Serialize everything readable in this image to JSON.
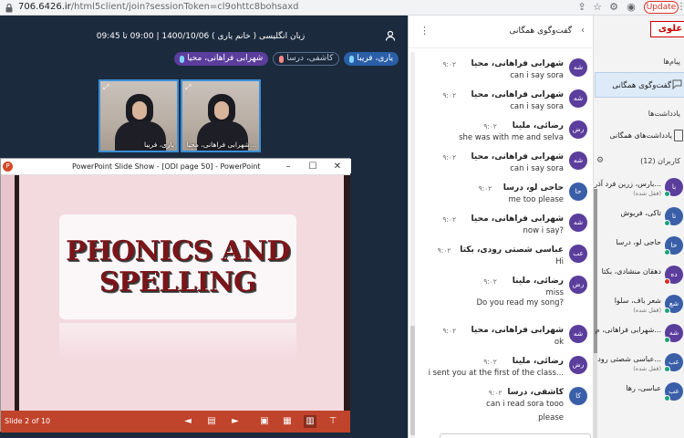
{
  "browser": {
    "url_host": "706.6426.ir",
    "url_path": "/html5client/join?sessionToken=cl9ohttc8bohsaxd",
    "update_label": "Update"
  },
  "meeting": {
    "header": "زبان انگلیسی ( خانم یاری ) 1400/10/06 | 09:00 تا 09:45",
    "presenters": [
      {
        "name": "یاری، فریبا",
        "style": "blue"
      },
      {
        "name": "کاشفی، درسا",
        "style": "outline"
      },
      {
        "name": "شهرابی فراهانی، محیا",
        "style": "purple"
      }
    ],
    "videos": [
      {
        "name": "یاری، فریبا"
      },
      {
        "name": "شهرابی فراهانی، محیا..."
      }
    ]
  },
  "ppt": {
    "title": "PowerPoint Slide Show - [ODI page 50] - PowerPoint",
    "slide_title_line1": "PHONICS AND",
    "slide_title_line2": "SPELLING",
    "status": "Slide 2 of 10",
    "accent": "#c0432b"
  },
  "chat": {
    "title": "گفت‌وگوی همگانی",
    "messages": [
      {
        "avatar": "شه",
        "color": "#5b3d9c",
        "name": "شهرابی فراهانی، محیا",
        "time": "۹:۰۲",
        "text": "can i say sora"
      },
      {
        "avatar": "شه",
        "color": "#5b3d9c",
        "name": "شهرابی فراهانی، محیا",
        "time": "۹:۰۲",
        "text": "can i say sora"
      },
      {
        "avatar": "رض",
        "color": "#5b3d9c",
        "name": "رضائی، ملینا",
        "time": "۹:۰۲",
        "text": "she was with me and selva"
      },
      {
        "avatar": "شه",
        "color": "#5b3d9c",
        "name": "شهرابی فراهانی، محیا",
        "time": "۹:۰۲",
        "text": "can i say sora"
      },
      {
        "avatar": "حا",
        "color": "#3a5fa8",
        "name": "حاجی لو، درسا",
        "time": "۹:۰۲",
        "text": "me too please"
      },
      {
        "avatar": "شه",
        "color": "#5b3d9c",
        "name": "شهرابی فراهانی، محیا",
        "time": "۹:۰۲",
        "text": "now i say?"
      },
      {
        "avatar": "عب",
        "color": "#5b3d9c",
        "name": "عباسی شصتی رودی، بکتا",
        "time": "۹:۰۲",
        "text": "Hi"
      },
      {
        "avatar": "رض",
        "color": "#5b3d9c",
        "name": "رضائی، ملینا",
        "time": "۹:۰۲",
        "text": "miss"
      },
      {
        "avatar": "",
        "color": "#5b3d9c",
        "name": "",
        "time": "",
        "text": "Do you read my song?"
      },
      {
        "avatar": "شه",
        "color": "#5b3d9c",
        "name": "شهرابی فراهانی، محیا",
        "time": "۹:۰۲",
        "text": "ok"
      },
      {
        "avatar": "رض",
        "color": "#5b3d9c",
        "name": "رضائی، ملینا",
        "time": "۹:۰۲",
        "text": "i sent you at the first of the class..."
      },
      {
        "avatar": "کا",
        "color": "#3a5fa8",
        "name": "کاشفی، درسا",
        "time": "۹:۰۲",
        "text": "can i read sora tooo"
      },
      {
        "avatar": "",
        "color": "#3a5fa8",
        "name": "",
        "time": "",
        "text": "please"
      }
    ]
  },
  "sidebar": {
    "logo": "علوی",
    "messages_label": "پیام‌ها",
    "public_chat": "گفت‌وگوی همگانی",
    "notes_label": "یادداشت‌ها",
    "shared_notes": "یادداشت‌های همگانی",
    "users_label": "کاربران (12)",
    "users": [
      {
        "avatar": "با",
        "color": "#5b3d9c",
        "name": "بارس، زرین فرد آذر...",
        "sub": "(قفل شده)",
        "dot": "green"
      },
      {
        "avatar": "تا",
        "color": "#3a5fa8",
        "name": "تاکی، فریوش",
        "sub": "",
        "dot": "green"
      },
      {
        "avatar": "حا",
        "color": "#3a5fa8",
        "name": "حاجی لو، درسا",
        "sub": "",
        "dot": "green"
      },
      {
        "avatar": "ده",
        "color": "#5b3d9c",
        "name": "دهقان منشادی، بکتا",
        "sub": "",
        "dot": "red"
      },
      {
        "avatar": "شع",
        "color": "#3a5fa8",
        "name": "شعر باف، سلوا",
        "sub": "(قفل شده)",
        "dot": "green"
      },
      {
        "avatar": "شه",
        "color": "#5b3d9c",
        "name": "شهرابی فراهانی، م...",
        "sub": "",
        "dot": "green"
      },
      {
        "avatar": "عب",
        "color": "#3a5fa8",
        "name": "عباسی شصتی رود...",
        "sub": "(قفل شده)",
        "dot": "green"
      },
      {
        "avatar": "عب",
        "color": "#3a5fa8",
        "name": "عباسی، رها",
        "sub": "",
        "dot": "green"
      }
    ]
  }
}
